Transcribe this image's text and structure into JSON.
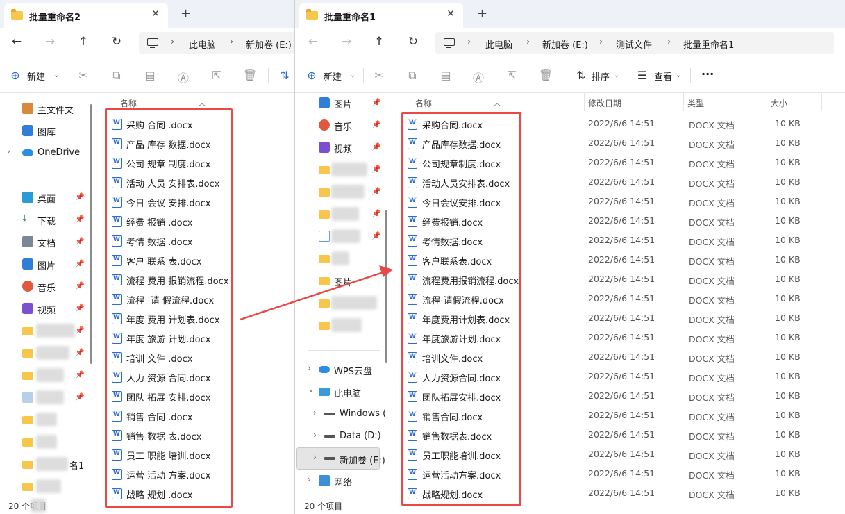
{
  "window_left": {
    "tab_title": "批量重命名2",
    "breadcrumb": [
      "此电脑",
      "新加卷 (E:)"
    ],
    "toolbar": {
      "new_label": "新建"
    },
    "nav": {
      "home": "主文件夹",
      "gallery": "图库",
      "onedrive": "OneDrive",
      "desktop": "桌面",
      "downloads": "下载",
      "documents": "文档",
      "pictures": "图片",
      "music": "音乐",
      "videos": "视频",
      "partial_rename": "名1"
    },
    "column_name": "名称",
    "files": [
      "采购 合同 .docx",
      "产品 库存 数据.docx",
      "公司 规章 制度.docx",
      "活动 人员 安排表.docx",
      "今日 会议 安排.docx",
      "经费 报销 .docx",
      "考情 数据 .docx",
      "客户 联系 表.docx",
      "流程 费用 报销流程.docx",
      "流程 -请 假流程.docx",
      "年度 费用 计划表.docx",
      "年度 旅游 计划.docx",
      "培训 文件 .docx",
      "人力 资源 合同.docx",
      "团队 拓展 安排.docx",
      "销售 合同 .docx",
      "销售 数据 表.docx",
      "员工 职能 培训.docx",
      "运营 活动 方案.docx",
      "战略 规划 .docx"
    ],
    "status": "20 个项目"
  },
  "window_right": {
    "tab_title": "批量重命名1",
    "breadcrumb": [
      "此电脑",
      "新加卷 (E:)",
      "测试文件",
      "批量重命名1"
    ],
    "toolbar": {
      "new_label": "新建",
      "sort_label": "排序",
      "view_label": "查看",
      "more_label": "···"
    },
    "nav": {
      "pictures": "图片",
      "music": "音乐",
      "videos": "视频",
      "pictures2": "图片",
      "wps": "WPS云盘",
      "this_pc": "此电脑",
      "windows": "Windows (",
      "data_d": "Data (D:)",
      "new_vol": "新加卷 (E:)",
      "network": "网络"
    },
    "columns": {
      "name": "名称",
      "date": "修改日期",
      "type": "类型",
      "size": "大小"
    },
    "files": [
      "采购合同.docx",
      "产品库存数据.docx",
      "公司规章制度.docx",
      "活动人员安排表.docx",
      "今日会议安排.docx",
      "经费报销.docx",
      "考情数据.docx",
      "客户联系表.docx",
      "流程费用报销流程.docx",
      "流程-请假流程.docx",
      "年度费用计划表.docx",
      "年度旅游计划.docx",
      "培训文件.docx",
      "人力资源合同.docx",
      "团队拓展安排.docx",
      "销售合同.docx",
      "销售数据表.docx",
      "员工职能培训.docx",
      "运营活动方案.docx",
      "战略规划.docx"
    ],
    "file_date": "2022/6/6 14:51",
    "file_type": "DOCX 文档",
    "file_size": "10 KB",
    "status": "20 个项目"
  },
  "colors": {
    "highlight": "#ea4747",
    "accent": "#2b6bd3"
  }
}
